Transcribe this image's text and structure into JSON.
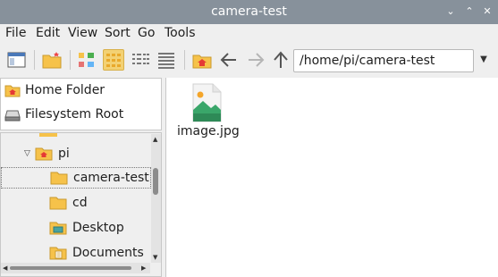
{
  "window": {
    "title": "camera-test"
  },
  "menu": {
    "items": [
      "File",
      "Edit",
      "View",
      "Sort",
      "Go",
      "Tools"
    ]
  },
  "toolbar": {
    "path_value": "/home/pi/camera-test",
    "active_view": "icon-view"
  },
  "places": {
    "items": [
      {
        "label": "Home Folder",
        "icon": "home-folder-icon"
      },
      {
        "label": "Filesystem Root",
        "icon": "drive-icon"
      }
    ]
  },
  "tree": {
    "parent": {
      "label": "pi",
      "expanded": true
    },
    "items": [
      {
        "label": "camera-test",
        "selected": true,
        "icon": "folder-icon"
      },
      {
        "label": "cd",
        "icon": "folder-icon"
      },
      {
        "label": "Desktop",
        "icon": "desktop-folder-icon"
      },
      {
        "label": "Documents",
        "icon": "documents-folder-icon"
      }
    ]
  },
  "files": [
    {
      "name": "image.jpg",
      "icon": "image-file-icon"
    }
  ],
  "colors": {
    "titlebar": "#87919b",
    "selection": "#f3d173",
    "folder": "#f6c24a",
    "image_green": "#3aa66a"
  }
}
